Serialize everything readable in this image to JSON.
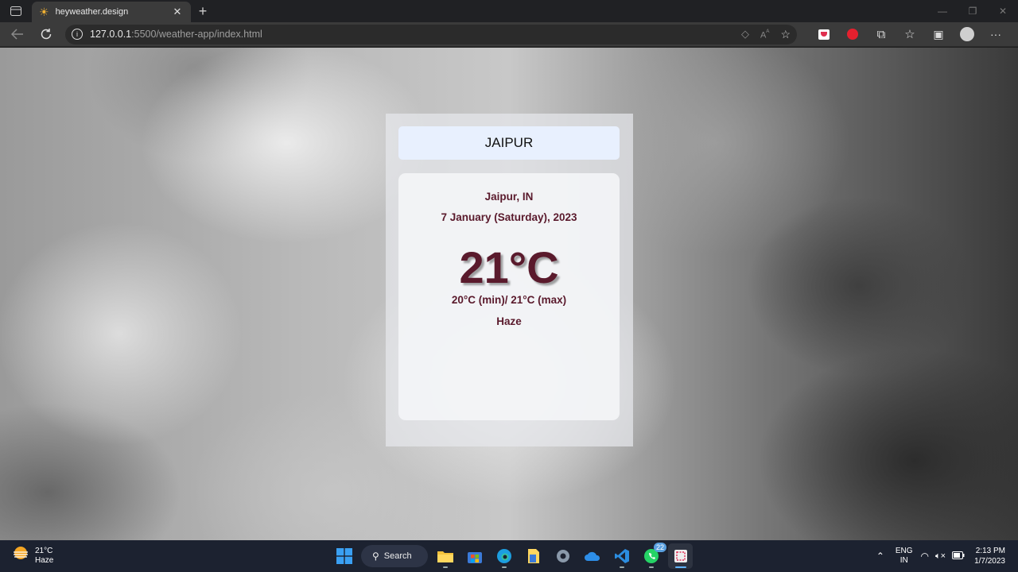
{
  "browser": {
    "tab_title": "heyweather.design",
    "url_host": "127.0.0.1",
    "url_rest": ":5500/weather-app/index.html"
  },
  "app": {
    "city_value": "JAIPUR",
    "location": "Jaipur, IN",
    "date": "7 January (Saturday), 2023",
    "temperature": "21°C",
    "min_max": "20°C (min)/ 21°C (max)",
    "condition": "Haze"
  },
  "taskbar": {
    "weather_temp": "21°C",
    "weather_desc": "Haze",
    "search_label": "Search",
    "whatsapp_badge": "22",
    "lang_line1": "ENG",
    "lang_line2": "IN",
    "time": "2:13 PM",
    "date": "1/7/2023"
  },
  "colors": {
    "accent_text": "#5a1a2c",
    "input_bg": "#e8f0fe",
    "taskbar_bg": "#1c2230"
  }
}
